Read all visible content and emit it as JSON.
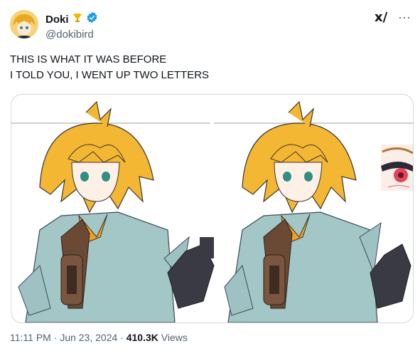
{
  "author": {
    "name": "Doki",
    "handle": "@dokibird",
    "trophy_icon": "trophy-icon",
    "verified_icon": "verified-badge-icon",
    "verified_color": "#1d9bf0"
  },
  "header": {
    "grok_label": "x/",
    "more_label": "···"
  },
  "tweet": {
    "line1": "THIS IS WHAT IT WAS BEFORE",
    "line2": "I TOLD YOU, I WENT UP TWO LETTERS"
  },
  "media": {
    "description_icons": [
      "anime-character-left",
      "anime-character-right",
      "eye-closeup"
    ]
  },
  "meta": {
    "time": "11:11 PM",
    "date": "Jun 23, 2024",
    "views_count": "410.3K",
    "views_label": "Views"
  }
}
